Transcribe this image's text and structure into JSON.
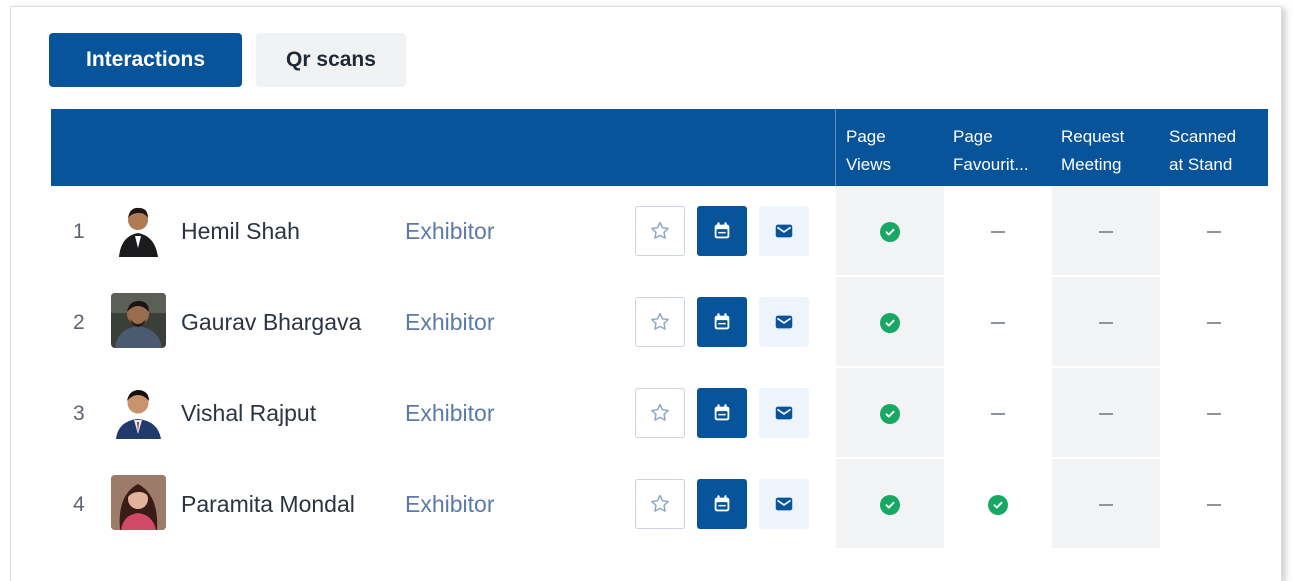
{
  "tabs": [
    {
      "label": "Interactions",
      "active": true
    },
    {
      "label": "Qr scans",
      "active": false
    }
  ],
  "columns": [
    {
      "line1": "Page",
      "line2": "Views"
    },
    {
      "line1": "Page",
      "line2": "Favourit..."
    },
    {
      "line1": "Request",
      "line2": "Meeting"
    },
    {
      "line1": "Scanned",
      "line2": "at Stand"
    }
  ],
  "rows": [
    {
      "index": "1",
      "name": "Hemil Shah",
      "role": "Exhibitor",
      "metrics": [
        true,
        false,
        false,
        false
      ]
    },
    {
      "index": "2",
      "name": "Gaurav Bhargava",
      "role": "Exhibitor",
      "metrics": [
        true,
        false,
        false,
        false
      ]
    },
    {
      "index": "3",
      "name": "Vishal Rajput",
      "role": "Exhibitor",
      "metrics": [
        true,
        false,
        false,
        false
      ]
    },
    {
      "index": "4",
      "name": "Paramita Mondal",
      "role": "Exhibitor",
      "metrics": [
        true,
        true,
        false,
        false
      ]
    }
  ],
  "icons": {
    "favourite": "star-icon",
    "meeting": "calendar-icon",
    "message": "mail-icon",
    "yes": "check-circle-icon",
    "no": "dash-icon"
  },
  "colors": {
    "primary": "#07549b",
    "success": "#17a864",
    "role_text": "#5c7aa8"
  }
}
